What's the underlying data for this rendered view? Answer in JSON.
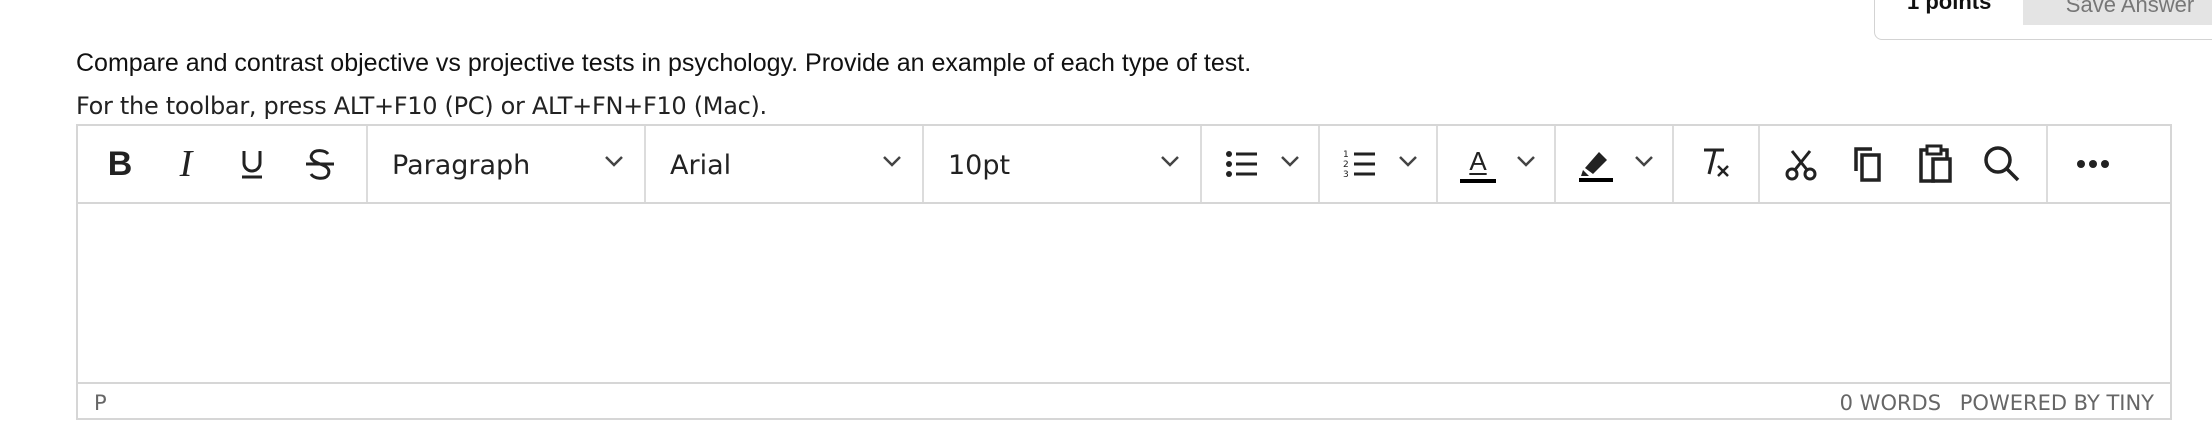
{
  "header": {
    "points_label": "1 points",
    "save_answer_label": "Save Answer"
  },
  "question": {
    "text": "Compare and contrast objective vs projective tests in psychology. Provide an example of each type of test.",
    "toolbar_hint": "For the toolbar, press ALT+F10 (PC) or ALT+FN+F10 (Mac)."
  },
  "editor": {
    "toolbar": {
      "bold_label": "B",
      "italic_label": "I",
      "block_format": "Paragraph",
      "font_family": "Arial",
      "font_size": "10pt",
      "text_color_letter": "A",
      "accent_color": "#000000",
      "icons": [
        "bold-icon",
        "italic-icon",
        "underline-icon",
        "strikethrough-icon",
        "bullet-list-icon",
        "numbered-list-icon",
        "text-color-icon",
        "highlight-icon",
        "clear-formatting-icon",
        "cut-icon",
        "copy-icon",
        "paste-icon",
        "search-icon",
        "more-icon"
      ]
    },
    "content": "",
    "statusbar": {
      "path": "P",
      "word_count": "0 WORDS",
      "branding": "POWERED BY TINY"
    }
  }
}
